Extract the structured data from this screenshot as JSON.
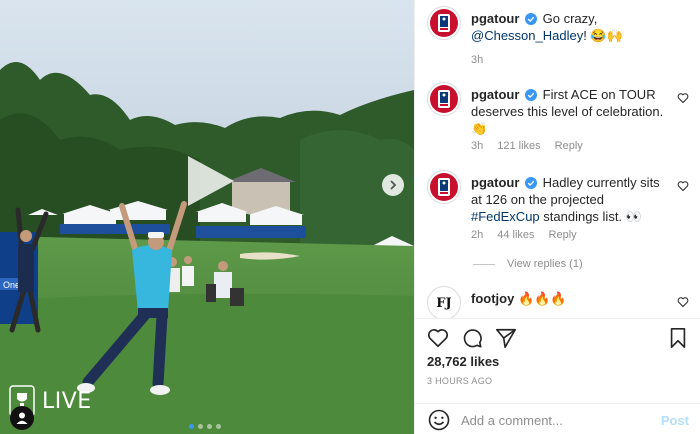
{
  "colors": {
    "link": "#00376b",
    "muted": "#8e8e8e",
    "post_disabled": "#b2dffc",
    "pga_red": "#c8102e",
    "verified_blue": "#3897f0"
  },
  "media": {
    "overlay_text": "LIVE",
    "sign_text": "One",
    "icons": [
      "play-icon",
      "chevron-right-icon",
      "user-tag-icon"
    ],
    "carousel": {
      "count": 4,
      "active": 0
    }
  },
  "comments": [
    {
      "username": "pgatour",
      "verified": true,
      "text_pre": "Go crazy,",
      "mention": "@Chesson_Hadley",
      "text_post": "! 😂🙌",
      "time": "3h"
    },
    {
      "username": "pgatour",
      "verified": true,
      "text": "First ACE on TOUR deserves this level of celebration. 👏",
      "time": "3h",
      "likes": "121 likes",
      "reply": "Reply"
    },
    {
      "username": "pgatour",
      "verified": true,
      "text_pre": "Hadley currently sits at 126 on the projected",
      "hashtag": "#FedExCup",
      "text_post": "standings list. 👀",
      "time": "2h",
      "likes": "44 likes",
      "reply": "Reply",
      "view_replies": "View replies (1)"
    },
    {
      "username": "footjoy",
      "verified": false,
      "avatar_text": "FJ",
      "text": "🔥🔥🔥"
    }
  ],
  "actions": {
    "icons": [
      "heart-icon",
      "comment-icon",
      "share-icon",
      "bookmark-icon"
    ]
  },
  "post": {
    "likes": "28,762 likes",
    "time": "3 HOURS AGO"
  },
  "add_comment": {
    "placeholder": "Add a comment...",
    "post_label": "Post"
  }
}
